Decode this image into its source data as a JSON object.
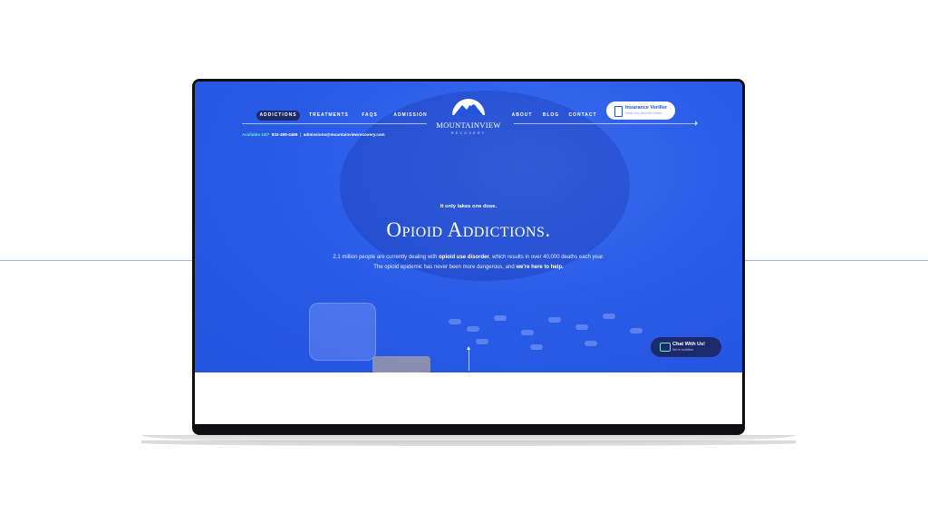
{
  "nav": {
    "left": [
      "ADDICTIONS",
      "TREATMENTS",
      "FAQS",
      "ADMISSION"
    ],
    "right": [
      "ABOUT",
      "BLOG",
      "CONTACT"
    ]
  },
  "contact": {
    "available": "Available 24/7",
    "phone": "833-489-4469",
    "separator": "|",
    "email": "admissions@mountainviewrecovery.com"
  },
  "logo": {
    "name": "MOUNTAINVIEW",
    "sub": "RECOVERY"
  },
  "insurance": {
    "title": "Insurance Verifier",
    "subtitle": "Verify Your Benefits Online"
  },
  "hero": {
    "tagline": "It only takes one dose.",
    "headline": "Opioid Addictions.",
    "body_1": "2.1 million people are currently dealing with ",
    "body_bold_1": "opioid use disorder",
    "body_2": ", which results in over 40,000 deaths each year. The opioid epidemic has never been more dangerous, and ",
    "body_bold_2": "we're here to help."
  },
  "chat": {
    "title": "Chat With Us!",
    "subtitle": "We're available"
  },
  "colors": {
    "hero_blue": "#2453de",
    "navy": "#1c2a6b",
    "accent_green": "#5ef0c8"
  }
}
